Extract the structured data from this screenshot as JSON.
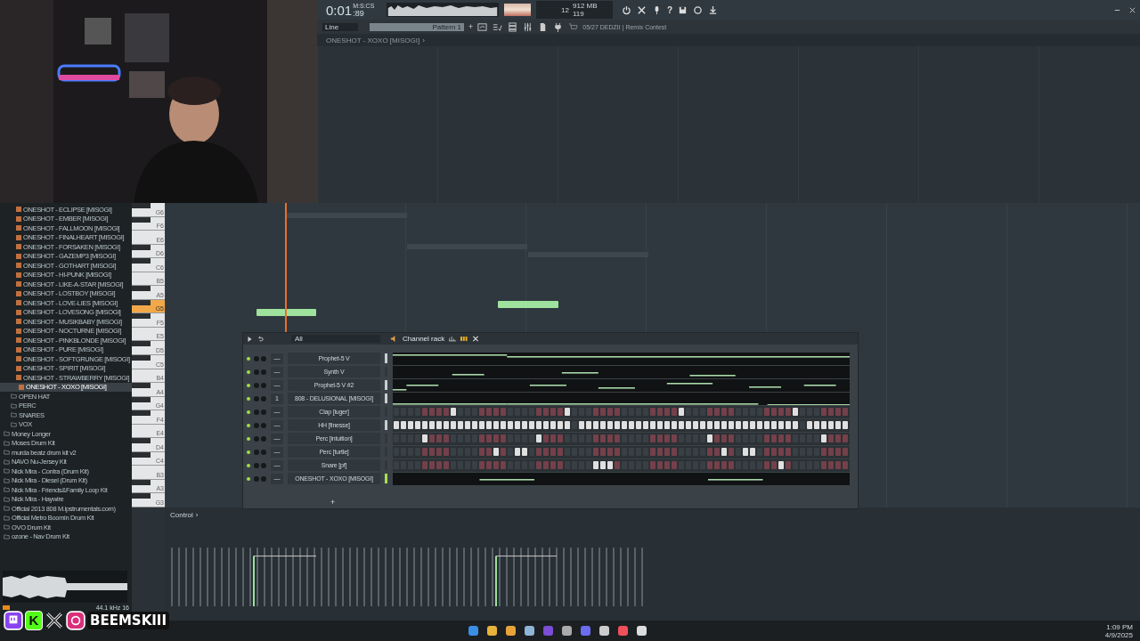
{
  "toolbar": {
    "time": "0:01",
    "time_cs": ":89",
    "time_format": "M:S:CS",
    "cpu": "12",
    "memory": "912 MB",
    "polyphony": "119",
    "snap": "Line",
    "pattern": "Pattern 1",
    "add_pattern": "+",
    "help": "?",
    "news": "05/27 DEDZII | Remix Contest"
  },
  "breadcrumb": {
    "path": "ONESHOT - XOXO [MISOGI]",
    "arrow": "›"
  },
  "browser": {
    "nested": [
      {
        "label": "ONESHOT - ECLIPSE [MISOGI]",
        "kind": "sample",
        "selected": false
      },
      {
        "label": "ONESHOT - EMBER [MISOGI]",
        "kind": "sample",
        "selected": false
      },
      {
        "label": "ONESHOT - FALLMOON [MISOGI]",
        "kind": "sample",
        "selected": false
      },
      {
        "label": "ONESHOT - FINALHEART [MISOGI]",
        "kind": "sample",
        "selected": false
      },
      {
        "label": "ONESHOT - FORSAKEN [MISOGI]",
        "kind": "sample",
        "selected": false
      },
      {
        "label": "ONESHOT - GAZEMP3 [MISOGI]",
        "kind": "sample",
        "selected": false
      },
      {
        "label": "ONESHOT - GOTHART [MISOGI]",
        "kind": "sample",
        "selected": false
      },
      {
        "label": "ONESHOT - HI-PUNK [MISOGI]",
        "kind": "sample",
        "selected": false
      },
      {
        "label": "ONESHOT - LIKE-A-STAR [MISOGI]",
        "kind": "sample",
        "selected": false
      },
      {
        "label": "ONESHOT - LOSTBOY [MISOGI]",
        "kind": "sample",
        "selected": false
      },
      {
        "label": "ONESHOT - LOVE-LIES [MISOGI]",
        "kind": "sample",
        "selected": false
      },
      {
        "label": "ONESHOT - LOVESONG [MISOGI]",
        "kind": "sample",
        "selected": false
      },
      {
        "label": "ONESHOT - MUSIKBABY [MISOGI]",
        "kind": "sample",
        "selected": false
      },
      {
        "label": "ONESHOT - NOCTURNE [MISOGI]",
        "kind": "sample",
        "selected": false
      },
      {
        "label": "ONESHOT - PINKBLONDE [MISOGI]",
        "kind": "sample",
        "selected": false
      },
      {
        "label": "ONESHOT - PURE [MISOGI]",
        "kind": "sample",
        "selected": false
      },
      {
        "label": "ONESHOT - SOFTGRUNGE [MISOGI]",
        "kind": "sample",
        "selected": false
      },
      {
        "label": "ONESHOT - SPIRIT [MISOGI]",
        "kind": "sample",
        "selected": false
      },
      {
        "label": "ONESHOT - STRAWBERRY [MISOGI]",
        "kind": "sample",
        "selected": false
      },
      {
        "label": "ONESHOT - XOXO [MISOGI]",
        "kind": "sample",
        "selected": true
      },
      {
        "label": "OPEN HAT",
        "kind": "folder",
        "selected": false
      },
      {
        "label": "PERC",
        "kind": "folder",
        "selected": false
      },
      {
        "label": "SNARES",
        "kind": "folder",
        "selected": false
      },
      {
        "label": "VOX",
        "kind": "folder",
        "selected": false
      }
    ],
    "folders": [
      "Money Longer",
      "Moses Drum Kit",
      "murda beatz drum kit v2",
      "NAVO Nu-Jersey Kit",
      "Nick Mira - Contra (Drum Kit)",
      "Nick Mira - Diesel (Drum Kit)",
      "Nick Mira - Friends&Family Loop Kit",
      "Nick Mira - Haywire",
      "Official 2013 808 M.ipstrumentals.com)",
      "Official Metro Boomin Drum Kit",
      "OVO Drum Kit",
      "ozone - Nav Drum Kit"
    ],
    "preview_info": "44.1 kHz 16"
  },
  "piano_keys": [
    {
      "label": "G6",
      "selected": false
    },
    {
      "label": "F6",
      "selected": false
    },
    {
      "label": "E6",
      "selected": false
    },
    {
      "label": "D6",
      "selected": false
    },
    {
      "label": "C6",
      "selected": false
    },
    {
      "label": "B5",
      "selected": false
    },
    {
      "label": "A5",
      "selected": false
    },
    {
      "label": "G5",
      "selected": true
    },
    {
      "label": "F5",
      "selected": false
    },
    {
      "label": "E5",
      "selected": false
    },
    {
      "label": "D5",
      "selected": false
    },
    {
      "label": "C5",
      "selected": false
    },
    {
      "label": "B4",
      "selected": false
    },
    {
      "label": "A4",
      "selected": false
    },
    {
      "label": "G4",
      "selected": false
    },
    {
      "label": "F4",
      "selected": false
    },
    {
      "label": "E4",
      "selected": false
    },
    {
      "label": "D4",
      "selected": false
    },
    {
      "label": "C4",
      "selected": false
    },
    {
      "label": "B3",
      "selected": false
    },
    {
      "label": "A3",
      "selected": false
    },
    {
      "label": "G3",
      "selected": false
    }
  ],
  "event_editor": {
    "label": "Control",
    "arrow": "›"
  },
  "channel_rack": {
    "filter": "All",
    "title": "Channel rack",
    "add": "+",
    "channels": [
      {
        "name": "Prophet-5 V",
        "target": "—",
        "kind": "notes",
        "selected": true,
        "focused": false
      },
      {
        "name": "Synth V",
        "target": "—",
        "kind": "notes",
        "selected": false,
        "focused": false
      },
      {
        "name": "Prophet-5 V #2",
        "target": "—",
        "kind": "notes",
        "selected": true,
        "focused": false
      },
      {
        "name": "808 - DELUSIONAL [MISOGI]",
        "target": "1",
        "kind": "notes",
        "selected": true,
        "focused": false
      },
      {
        "name": "Clap [luger]",
        "target": "—",
        "kind": "steps",
        "selected": false,
        "focused": false,
        "steps": [
          false,
          false,
          false,
          false,
          false,
          false,
          false,
          false,
          true,
          false,
          false,
          false,
          false,
          false,
          false,
          false,
          false,
          false,
          false,
          false,
          false,
          false,
          false,
          false,
          true,
          false,
          false,
          false,
          false,
          false,
          false,
          false,
          false,
          false,
          false,
          false,
          false,
          false,
          false,
          false,
          true,
          false,
          false,
          false,
          false,
          false,
          false,
          false,
          false,
          false,
          false,
          false,
          false,
          false,
          false,
          false,
          true,
          false,
          false,
          false,
          false,
          false,
          false,
          false
        ]
      },
      {
        "name": "HH [finesse]",
        "target": "—",
        "kind": "steps",
        "selected": true,
        "focused": false,
        "steps": [
          true,
          true,
          true,
          true,
          true,
          true,
          true,
          true,
          true,
          true,
          true,
          true,
          true,
          true,
          true,
          true,
          true,
          true,
          true,
          true,
          true,
          true,
          true,
          true,
          true,
          false,
          true,
          true,
          true,
          true,
          true,
          true,
          true,
          true,
          true,
          true,
          true,
          true,
          true,
          true,
          true,
          true,
          true,
          true,
          true,
          true,
          true,
          true,
          true,
          true,
          true,
          true,
          true,
          true,
          true,
          true,
          true,
          false,
          true,
          true,
          true,
          true,
          true,
          true
        ]
      },
      {
        "name": "Perc [intuition]",
        "target": "—",
        "kind": "steps",
        "selected": false,
        "focused": false,
        "steps": [
          false,
          false,
          false,
          false,
          true,
          false,
          false,
          false,
          false,
          false,
          false,
          false,
          false,
          false,
          false,
          false,
          false,
          false,
          false,
          false,
          true,
          false,
          false,
          false,
          false,
          false,
          false,
          false,
          false,
          false,
          false,
          false,
          false,
          false,
          false,
          false,
          false,
          false,
          false,
          false,
          false,
          false,
          false,
          false,
          true,
          false,
          false,
          false,
          false,
          false,
          false,
          false,
          false,
          false,
          false,
          false,
          false,
          false,
          false,
          false,
          true,
          false,
          false,
          false
        ]
      },
      {
        "name": "Perc [turtle]",
        "target": "—",
        "kind": "steps",
        "selected": false,
        "focused": false,
        "steps": [
          false,
          false,
          false,
          false,
          false,
          false,
          false,
          false,
          false,
          false,
          false,
          false,
          false,
          false,
          true,
          false,
          false,
          true,
          true,
          false,
          false,
          false,
          false,
          false,
          false,
          false,
          false,
          false,
          false,
          false,
          false,
          false,
          false,
          false,
          false,
          false,
          false,
          false,
          false,
          false,
          false,
          false,
          false,
          false,
          false,
          false,
          true,
          false,
          false,
          true,
          true,
          false,
          false,
          false,
          false,
          false,
          false,
          false,
          false,
          false,
          false,
          false,
          false,
          false
        ]
      },
      {
        "name": "Snare [pf]",
        "target": "—",
        "kind": "steps",
        "selected": false,
        "focused": false,
        "steps": [
          false,
          false,
          false,
          false,
          false,
          false,
          false,
          false,
          false,
          false,
          false,
          false,
          false,
          false,
          false,
          false,
          false,
          false,
          false,
          false,
          false,
          false,
          false,
          false,
          false,
          false,
          false,
          false,
          true,
          true,
          true,
          false,
          false,
          false,
          false,
          false,
          false,
          false,
          false,
          false,
          false,
          false,
          false,
          false,
          false,
          false,
          false,
          false,
          false,
          false,
          false,
          false,
          false,
          false,
          true,
          false,
          false,
          false,
          false,
          false,
          false,
          false,
          false,
          false
        ]
      },
      {
        "name": "ONESHOT - XOXO [MISOGI]",
        "target": "—",
        "kind": "notes",
        "selected": true,
        "focused": true
      }
    ]
  },
  "taskbar": {
    "clock": "1:09 PM",
    "date": "4/9/2025"
  },
  "overlay": {
    "handle": "BEEMSKIII",
    "kick": "K"
  }
}
